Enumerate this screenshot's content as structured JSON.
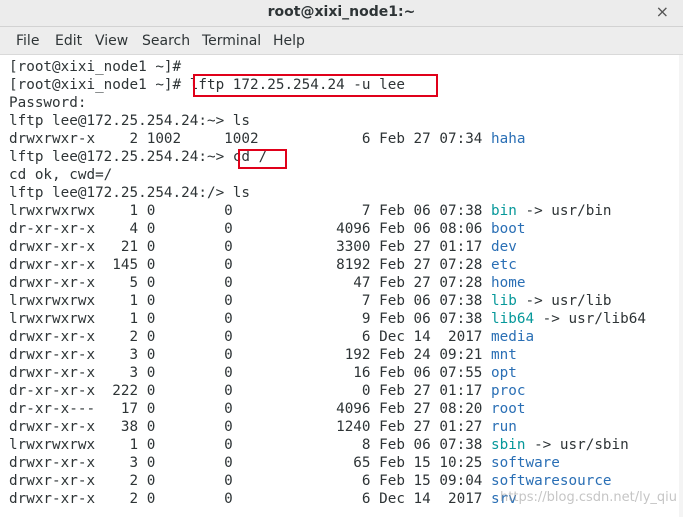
{
  "window": {
    "title": "root@xixi_node1:~",
    "close_glyph": "×"
  },
  "menu": [
    "File",
    "Edit",
    "View",
    "Search",
    "Terminal",
    "Help"
  ],
  "lines": [
    [
      {
        "t": "[root@xixi_node1 ~]#",
        "c": "txt"
      }
    ],
    [
      {
        "t": "[root@xixi_node1 ~]# ",
        "c": "txt"
      },
      {
        "t": "lftp 172.25.254.24 -u lee",
        "c": "txt"
      }
    ],
    [
      {
        "t": "Password:",
        "c": "txt"
      }
    ],
    [
      {
        "t": "lftp lee@172.25.254.24:~> ls",
        "c": "txt"
      }
    ],
    [
      {
        "t": "drwxrwxr-x    2 1002     1002            6 Feb 27 07:34 ",
        "c": "txt"
      },
      {
        "t": "haha",
        "c": "dir"
      }
    ],
    [
      {
        "t": "lftp lee@172.25.254.24:~> ",
        "c": "txt"
      },
      {
        "t": "cd /",
        "c": "txt"
      }
    ],
    [
      {
        "t": "cd ok, cwd=/",
        "c": "txt"
      }
    ],
    [
      {
        "t": "lftp lee@172.25.254.24:/> ls",
        "c": "txt"
      }
    ],
    [
      {
        "t": "lrwxrwxrwx    1 0        0               7 Feb 06 07:38 ",
        "c": "txt"
      },
      {
        "t": "bin",
        "c": "link"
      },
      {
        "t": " -> usr/bin",
        "c": "txt"
      }
    ],
    [
      {
        "t": "dr-xr-xr-x    4 0        0            4096 Feb 06 08:06 ",
        "c": "txt"
      },
      {
        "t": "boot",
        "c": "dir"
      }
    ],
    [
      {
        "t": "drwxr-xr-x   21 0        0            3300 Feb 27 01:17 ",
        "c": "txt"
      },
      {
        "t": "dev",
        "c": "dir"
      }
    ],
    [
      {
        "t": "drwxr-xr-x  145 0        0            8192 Feb 27 07:28 ",
        "c": "txt"
      },
      {
        "t": "etc",
        "c": "dir"
      }
    ],
    [
      {
        "t": "drwxr-xr-x    5 0        0              47 Feb 27 07:28 ",
        "c": "txt"
      },
      {
        "t": "home",
        "c": "dir"
      }
    ],
    [
      {
        "t": "lrwxrwxrwx    1 0        0               7 Feb 06 07:38 ",
        "c": "txt"
      },
      {
        "t": "lib",
        "c": "link"
      },
      {
        "t": " -> usr/lib",
        "c": "txt"
      }
    ],
    [
      {
        "t": "lrwxrwxrwx    1 0        0               9 Feb 06 07:38 ",
        "c": "txt"
      },
      {
        "t": "lib64",
        "c": "link"
      },
      {
        "t": " -> usr/lib64",
        "c": "txt"
      }
    ],
    [
      {
        "t": "drwxr-xr-x    2 0        0               6 Dec 14  2017 ",
        "c": "txt"
      },
      {
        "t": "media",
        "c": "dir"
      }
    ],
    [
      {
        "t": "drwxr-xr-x    3 0        0             192 Feb 24 09:21 ",
        "c": "txt"
      },
      {
        "t": "mnt",
        "c": "dir"
      }
    ],
    [
      {
        "t": "drwxr-xr-x    3 0        0              16 Feb 06 07:55 ",
        "c": "txt"
      },
      {
        "t": "opt",
        "c": "dir"
      }
    ],
    [
      {
        "t": "dr-xr-xr-x  222 0        0               0 Feb 27 01:17 ",
        "c": "txt"
      },
      {
        "t": "proc",
        "c": "dir"
      }
    ],
    [
      {
        "t": "dr-xr-x---   17 0        0            4096 Feb 27 08:20 ",
        "c": "txt"
      },
      {
        "t": "root",
        "c": "dir"
      }
    ],
    [
      {
        "t": "drwxr-xr-x   38 0        0            1240 Feb 27 01:27 ",
        "c": "txt"
      },
      {
        "t": "run",
        "c": "dir"
      }
    ],
    [
      {
        "t": "lrwxrwxrwx    1 0        0               8 Feb 06 07:38 ",
        "c": "txt"
      },
      {
        "t": "sbin",
        "c": "link"
      },
      {
        "t": " -> usr/sbin",
        "c": "txt"
      }
    ],
    [
      {
        "t": "drwxr-xr-x    3 0        0              65 Feb 15 10:25 ",
        "c": "txt"
      },
      {
        "t": "software",
        "c": "dir"
      }
    ],
    [
      {
        "t": "drwxr-xr-x    2 0        0               6 Feb 15 09:04 ",
        "c": "txt"
      },
      {
        "t": "softwaresource",
        "c": "dir"
      }
    ],
    [
      {
        "t": "drwxr-xr-x    2 0        0               6 Dec 14  2017 ",
        "c": "txt"
      },
      {
        "t": "srv",
        "c": "dir"
      }
    ]
  ],
  "watermark": "https://blog.csdn.net/ly_qiu",
  "colors": {
    "directory": "#2a6fb5",
    "symlink": "#06989a",
    "text": "#2e3436",
    "highlight": "#e0001a"
  }
}
